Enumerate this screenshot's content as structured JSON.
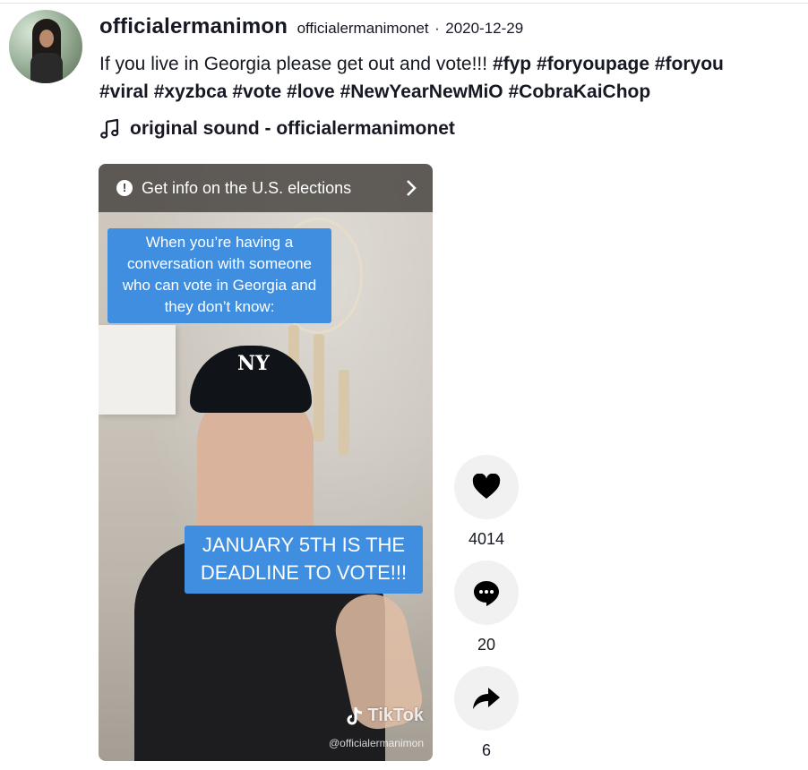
{
  "author": {
    "unique_id": "officialermanimon",
    "nickname": "officialermanimonet",
    "separator": "·",
    "date": "2020-12-29"
  },
  "caption": {
    "text": "If you live in Georgia please get out and vote!!! ",
    "hashtags": [
      "#fyp",
      "#foryoupage",
      "#foryou",
      "#viral",
      "#xyzbca",
      "#vote",
      "#love",
      "#NewYearNewMiO",
      "#CobraKaiChop"
    ]
  },
  "music": {
    "icon": "music-note-icon",
    "title": "original sound - officialermanimonet"
  },
  "video": {
    "info_banner": "Get info on the U.S. elections",
    "overlay_top": "When you’re having a conversation with someone who can vote in Georgia and they don’t know:",
    "overlay_bottom": "JANUARY 5TH IS THE DEADLINE TO VOTE!!!",
    "watermark": "TikTok",
    "watermark_user": "@officialermanimon"
  },
  "stats": {
    "likes": "4014",
    "comments": "20",
    "shares": "6"
  },
  "colors": {
    "text": "#161823",
    "caption_box": "#3f8ee0",
    "action_bg": "#f1f1f2"
  }
}
